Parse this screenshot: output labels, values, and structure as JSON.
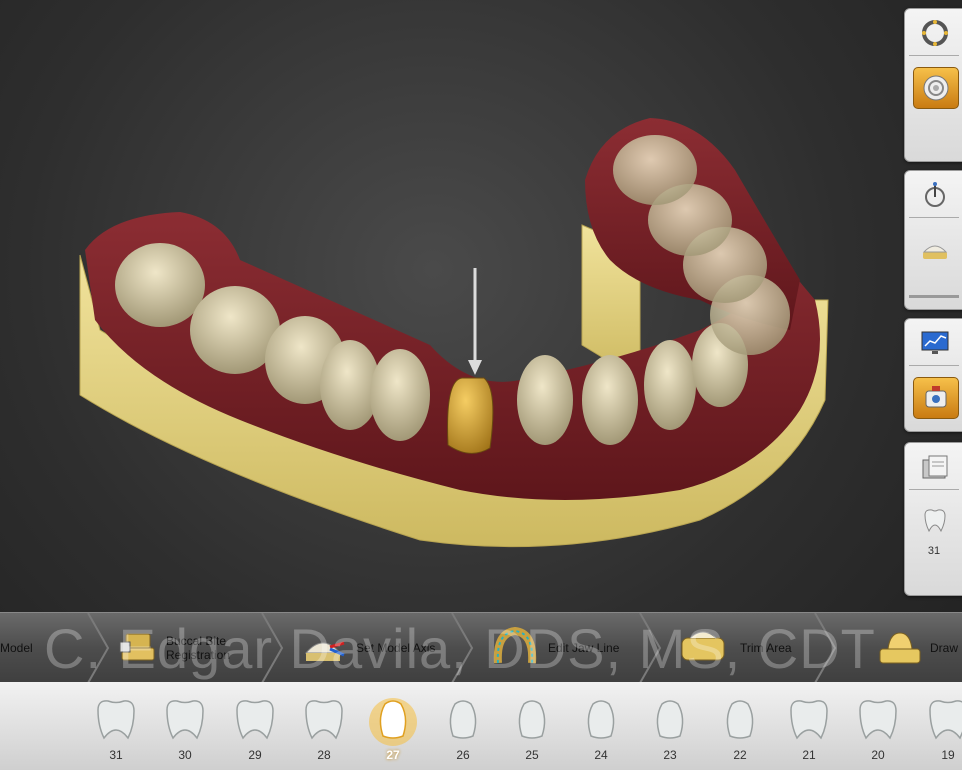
{
  "colors": {
    "accent": "#f0b030",
    "base_yellow": "#e8d68a",
    "gum": "#7a2228"
  },
  "viewport": {
    "model_name": "dental-arch-model"
  },
  "right_panel": {
    "groups": [
      {
        "buttons": [
          {
            "icon": "wheel-icon"
          },
          {
            "icon": "spiral-icon",
            "active": true
          }
        ]
      },
      {
        "buttons": [
          {
            "icon": "probe-icon"
          },
          {
            "icon": "jaw-model-icon"
          }
        ]
      },
      {
        "buttons": [
          {
            "icon": "monitor-chart-icon"
          },
          {
            "icon": "scanner-icon",
            "active": true
          }
        ]
      },
      {
        "buttons": [
          {
            "icon": "folder-icon"
          },
          {
            "icon": "tooth-icon"
          }
        ],
        "label": "31"
      }
    ]
  },
  "workflow": {
    "steps": [
      {
        "label": "Model"
      },
      {
        "label": "Buccal Bite\nRegistration"
      },
      {
        "label": "Set Model Axis"
      },
      {
        "label": "Edit Jaw Line"
      },
      {
        "label": "Trim Area"
      },
      {
        "label": "Draw"
      }
    ]
  },
  "watermark": "C. Edgar Davila, DDS, MS, CDT",
  "teeth": [
    "31",
    "30",
    "29",
    "28",
    "27",
    "26",
    "25",
    "24",
    "23",
    "22",
    "21",
    "20",
    "19"
  ],
  "selected_tooth": "27"
}
